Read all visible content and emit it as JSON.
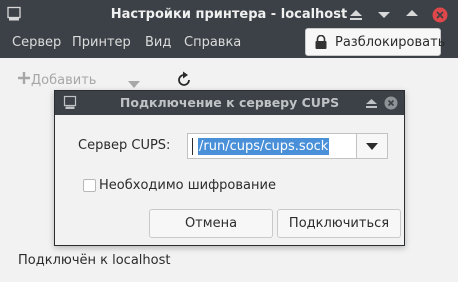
{
  "window": {
    "title": "Настройки принтера - localhost"
  },
  "menu": {
    "items": [
      "Сервер",
      "Принтер",
      "Вид",
      "Справка"
    ]
  },
  "unlock_button": {
    "label": "Разблокировать",
    "icon": "lock-icon"
  },
  "toolbar": {
    "add_label": "Добавить",
    "add_icon": "plus-icon",
    "dropdown_icon": "triangle-down-icon",
    "refresh_icon": "refresh-icon"
  },
  "dialog": {
    "title": "Подключение к серверу CUPS",
    "server_label": "Сервер CUPS:",
    "server_value": "/run/cups/cups.sock",
    "encryption_label": "Необходимо шифрование",
    "encryption_checked": false,
    "cancel_label": "Отмена",
    "connect_label": "Подключиться"
  },
  "status": {
    "text": "Подключён к localhost"
  },
  "colors": {
    "titlebar_bg": "#3b4146",
    "window_bg": "#f2f2f2",
    "selection": "#4a90d9",
    "close_button": "#e0474b"
  }
}
